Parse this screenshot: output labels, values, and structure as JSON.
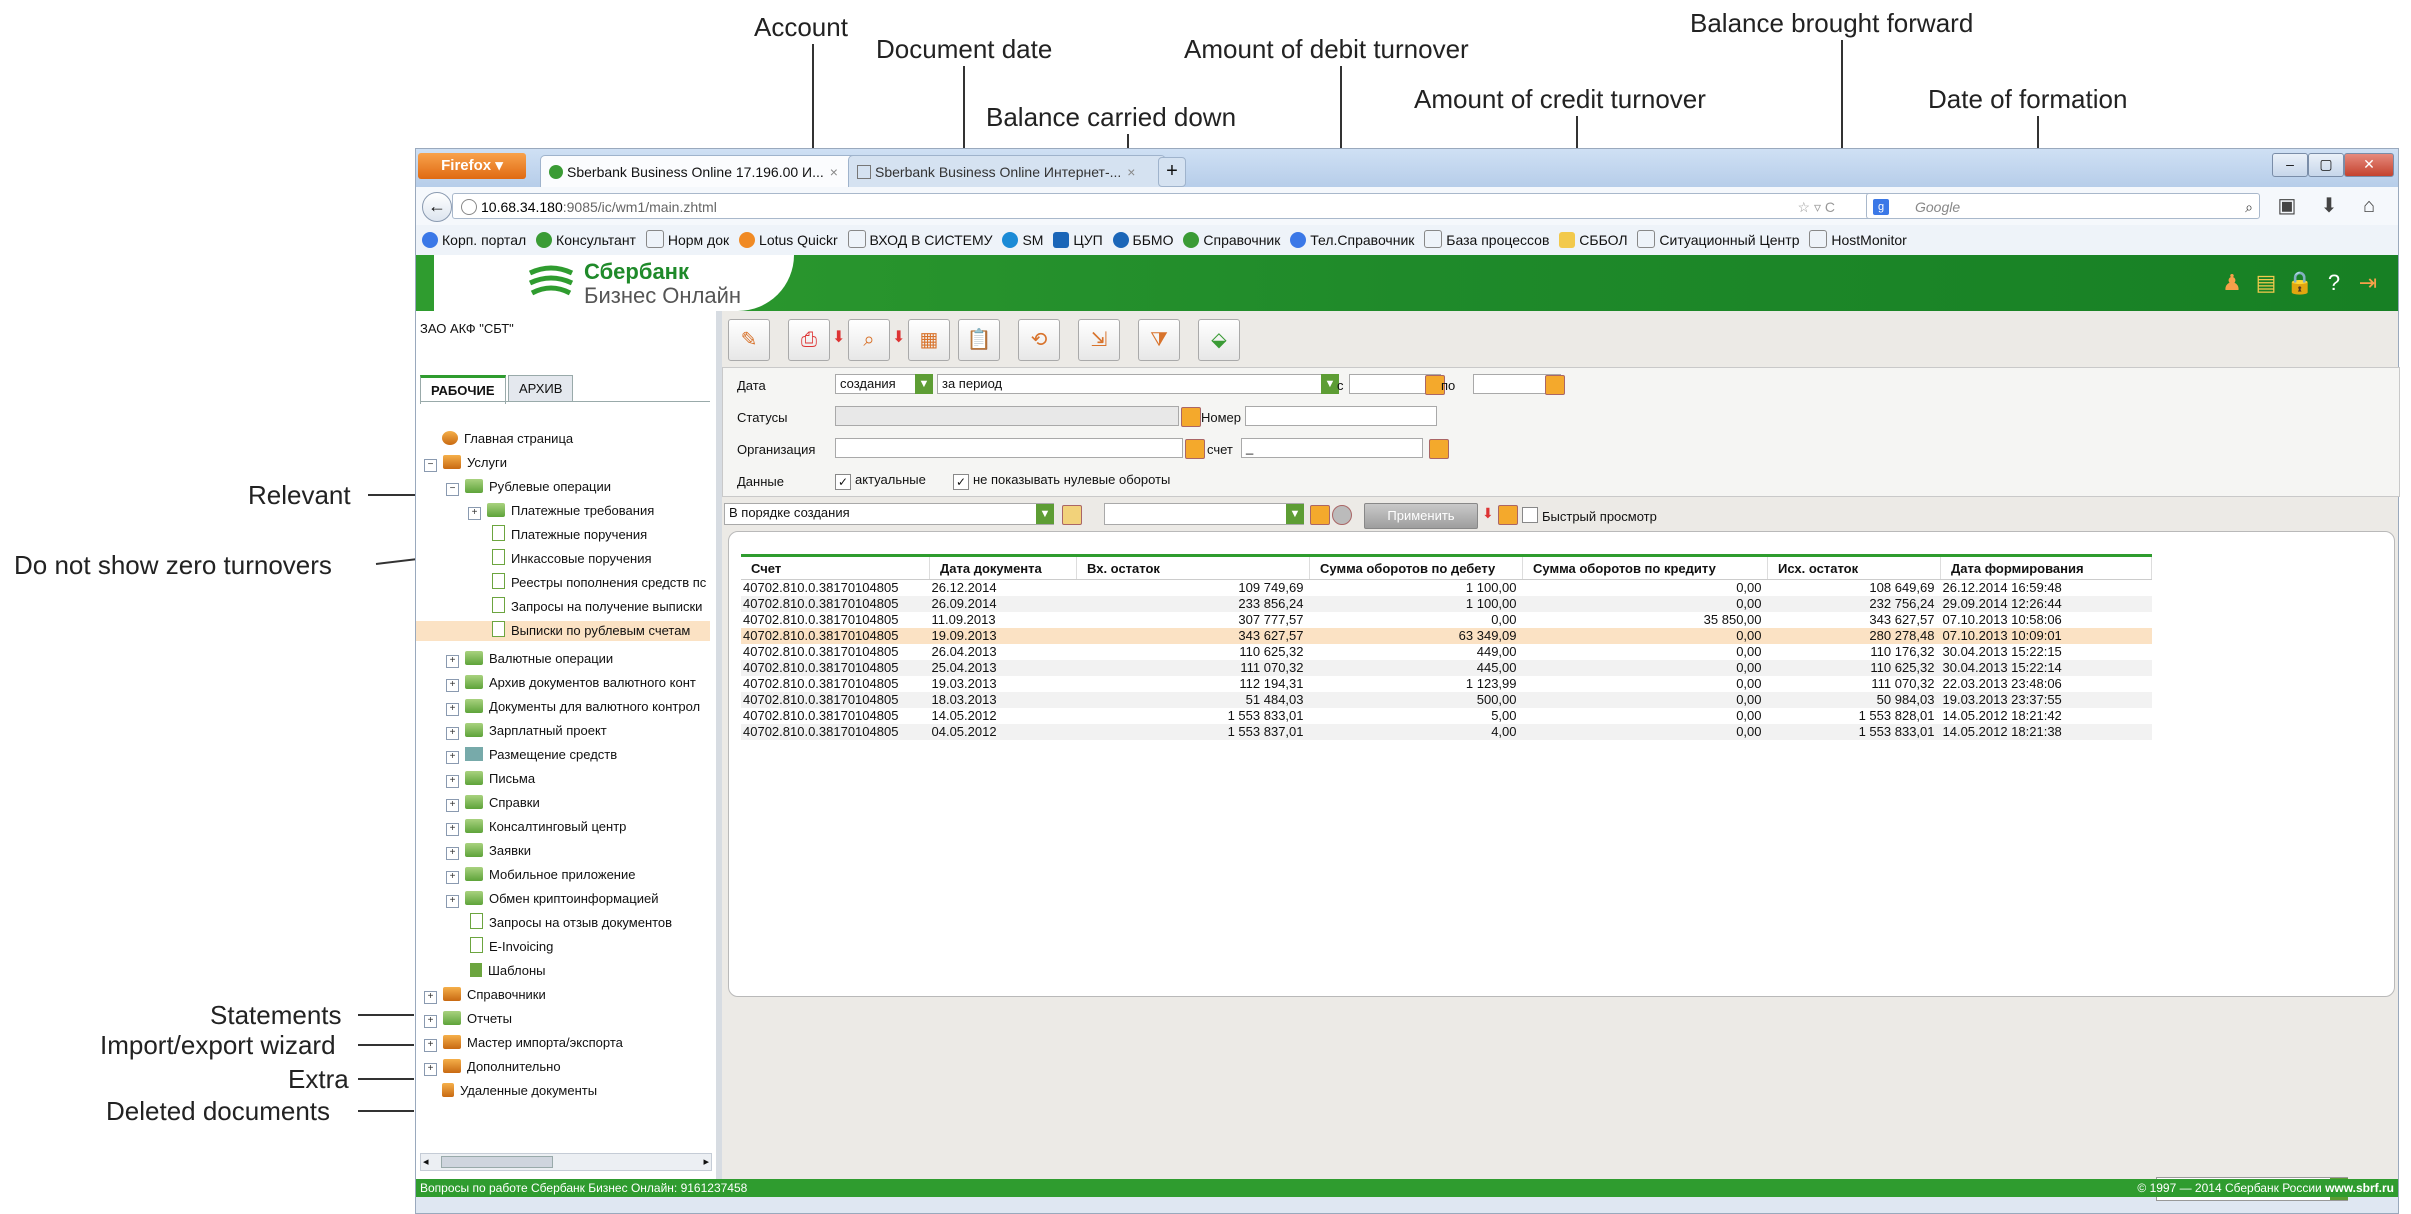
{
  "annotations": {
    "account": "Account",
    "document_date": "Document date",
    "debit_turnover": "Amount of debit turnover",
    "balance_brought_forward": "Balance brought forward",
    "balance_carried_down": "Balance carried down",
    "credit_turnover": "Amount of credit turnover",
    "date_of_formation": "Date of formation",
    "relevant": "Relevant",
    "no_zero_turnovers": "Do not show zero turnovers",
    "statements": "Statements",
    "import_export": "Import/export wizard",
    "extra": "Extra",
    "deleted_documents": "Deleted documents"
  },
  "browser": {
    "menu_button": "Firefox",
    "tabs": [
      {
        "label": "Sberbank Business Online 17.196.00 И..."
      },
      {
        "label": "Sberbank Business Online Интернет-..."
      }
    ],
    "new_tab": "+",
    "url_host": "10.68.34.180",
    "url_rest": ":9085/ic/wm1/main.zhtml",
    "search_placeholder": "Google",
    "bookmarks": [
      "Корп. портал",
      "Консультант",
      "Норм док",
      "Lotus Quickr",
      "ВХОД В СИСТЕМУ",
      "SM",
      "ЦУП",
      "ББМО",
      "Справочник",
      "Тел.Справочник",
      "База процессов",
      "СББОЛ",
      "Ситуационный Центр",
      "HostMonitor"
    ]
  },
  "app": {
    "logo_line1": "Сбербанк",
    "logo_line2": "Бизнес Онлайн",
    "org": "ЗАО АКФ \"СБТ\"",
    "tab_work": "РАБОЧИЕ",
    "tab_archive": "АРХИВ",
    "status_left": "Вопросы по работе Сбербанк Бизнес Онлайн: 9161237458",
    "status_right": "© 1997 — 2014 Сбербанк России",
    "status_site": "www.sbrf.ru"
  },
  "tree": [
    {
      "label": "Главная страница"
    },
    {
      "label": "Услуги"
    },
    {
      "label": "Рублевые операции"
    },
    {
      "label": "Платежные требования"
    },
    {
      "label": "Платежные поручения"
    },
    {
      "label": "Инкассовые поручения"
    },
    {
      "label": "Реестры пополнения средств пс"
    },
    {
      "label": "Запросы на получение выписки"
    },
    {
      "label": "Выписки по рублевым счетам"
    },
    {
      "label": "Валютные операции"
    },
    {
      "label": "Архив документов валютного конт"
    },
    {
      "label": "Документы для валютного контрол"
    },
    {
      "label": "Зарплатный проект"
    },
    {
      "label": "Размещение средств"
    },
    {
      "label": "Письма"
    },
    {
      "label": "Справки"
    },
    {
      "label": "Консалтинговый центр"
    },
    {
      "label": "Заявки"
    },
    {
      "label": "Мобильное приложение"
    },
    {
      "label": "Обмен криптоинформацией"
    },
    {
      "label": "Запросы на отзыв документов"
    },
    {
      "label": "E-Invoicing"
    },
    {
      "label": "Шаблоны"
    },
    {
      "label": "Справочники"
    },
    {
      "label": "Отчеты"
    },
    {
      "label": "Мастер импорта/экспорта"
    },
    {
      "label": "Дополнительно"
    },
    {
      "label": "Удаленные документы"
    }
  ],
  "filter": {
    "date_label": "Дата",
    "date_type": "создания",
    "period": "за период",
    "from_label": "с",
    "to_label": "по",
    "statuses_label": "Статусы",
    "number_label": "Номер",
    "org_label": "Организация",
    "account_label": "счет",
    "account_value": "_",
    "data_label": "Данные",
    "relevant_label": "актуальные",
    "no_zero_label": "не показывать нулевые обороты",
    "sort_value": "В порядке создания",
    "apply_button": "Применить",
    "quick_view": "Быстрый просмотр"
  },
  "grid": {
    "columns": [
      "Счет",
      "Дата документа",
      "Вх. остаток",
      "Сумма оборотов по дебету",
      "Сумма оборотов по кредиту",
      "Исх. остаток",
      "Дата формирования"
    ],
    "rows": [
      [
        "40702.810.0.38170104805",
        "26.12.2014",
        "109 749,69",
        "1 100,00",
        "0,00",
        "108 649,69",
        "26.12.2014 16:59:48"
      ],
      [
        "40702.810.0.38170104805",
        "26.09.2014",
        "233 856,24",
        "1 100,00",
        "0,00",
        "232 756,24",
        "29.09.2014 12:26:44"
      ],
      [
        "40702.810.0.38170104805",
        "11.09.2013",
        "307 777,57",
        "0,00",
        "35 850,00",
        "343 627,57",
        "07.10.2013 10:58:06"
      ],
      [
        "40702.810.0.38170104805",
        "19.09.2013",
        "343 627,57",
        "63 349,09",
        "0,00",
        "280 278,48",
        "07.10.2013 10:09:01"
      ],
      [
        "40702.810.0.38170104805",
        "26.04.2013",
        "110 625,32",
        "449,00",
        "0,00",
        "110 176,32",
        "30.04.2013 15:22:15"
      ],
      [
        "40702.810.0.38170104805",
        "25.04.2013",
        "111 070,32",
        "445,00",
        "0,00",
        "110 625,32",
        "30.04.2013 15:22:14"
      ],
      [
        "40702.810.0.38170104805",
        "19.03.2013",
        "112 194,31",
        "1 123,99",
        "0,00",
        "111 070,32",
        "22.03.2013 23:48:06"
      ],
      [
        "40702.810.0.38170104805",
        "18.03.2013",
        "51 484,03",
        "500,00",
        "0,00",
        "50 984,03",
        "19.03.2013 23:37:55"
      ],
      [
        "40702.810.0.38170104805",
        "14.05.2012",
        "1 553 833,01",
        "5,00",
        "0,00",
        "1 553 828,01",
        "14.05.2012 18:21:42"
      ],
      [
        "40702.810.0.38170104805",
        "04.05.2012",
        "1 553 837,01",
        "4,00",
        "0,00",
        "1 553 833,01",
        "14.05.2012 18:21:38"
      ]
    ],
    "selected_row": 3,
    "page_size": "30"
  }
}
